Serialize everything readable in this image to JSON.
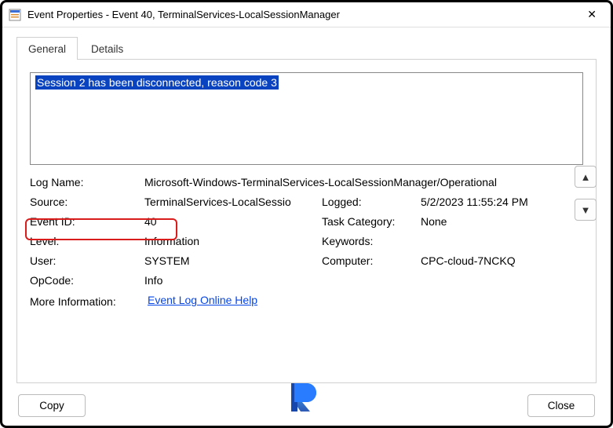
{
  "window": {
    "title": "Event Properties - Event 40, TerminalServices-LocalSessionManager"
  },
  "tabs": {
    "general": "General",
    "details": "Details"
  },
  "description": "Session 2 has been disconnected, reason code 3",
  "fields": {
    "log_name_label": "Log Name:",
    "log_name": "Microsoft-Windows-TerminalServices-LocalSessionManager/Operational",
    "source_label": "Source:",
    "source": "TerminalServices-LocalSessio",
    "logged_label": "Logged:",
    "logged": "5/2/2023 11:55:24 PM",
    "event_id_label": "Event ID:",
    "event_id": "40",
    "task_category_label": "Task Category:",
    "task_category": "None",
    "level_label": "Level:",
    "level": "Information",
    "keywords_label": "Keywords:",
    "keywords": "",
    "user_label": "User:",
    "user": "SYSTEM",
    "computer_label": "Computer:",
    "computer": "CPC-cloud-7NCKQ",
    "opcode_label": "OpCode:",
    "opcode": "Info",
    "moreinfo_label": "More Information:",
    "moreinfo_link": "Event Log Online Help"
  },
  "buttons": {
    "copy": "Copy",
    "close": "Close"
  }
}
